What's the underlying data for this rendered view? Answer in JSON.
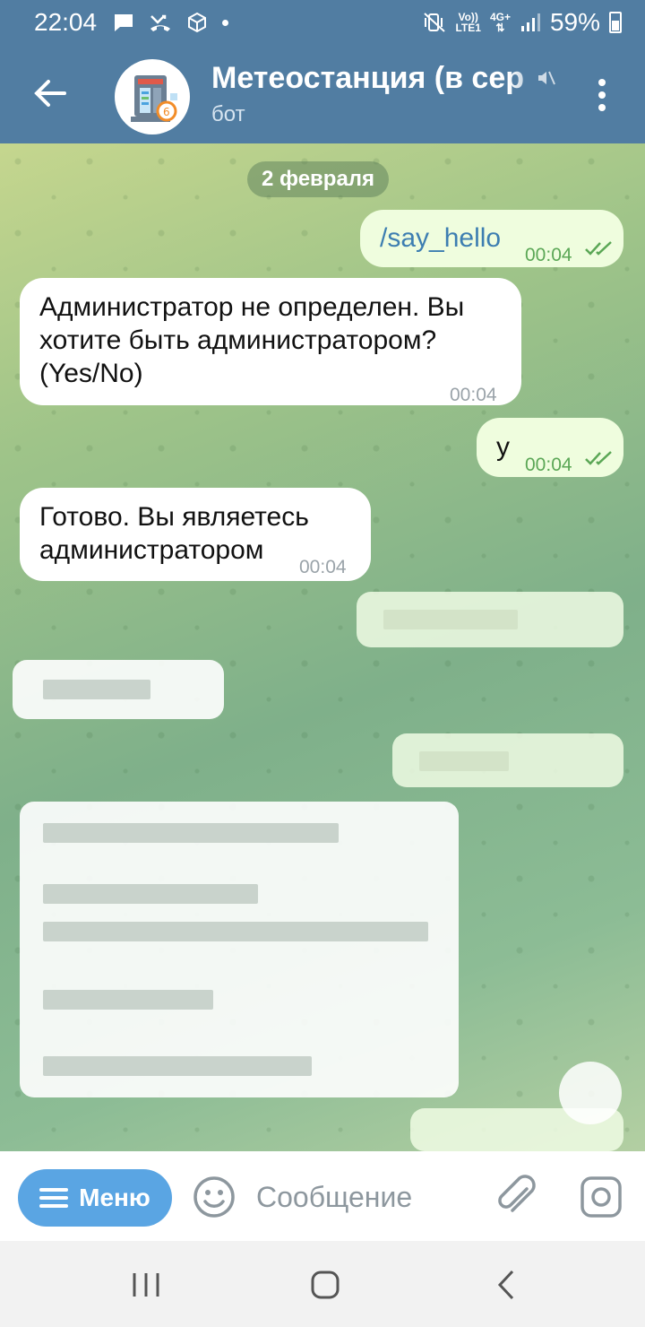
{
  "status_bar": {
    "time": "22:04",
    "network_top": "Vo))",
    "network_bottom": "LTE1",
    "network_type": "4G+",
    "battery": "59%"
  },
  "header": {
    "back_icon": "arrow-left-icon",
    "title": "Метеостанция (в сер",
    "subtitle": "бот",
    "muted_icon": "mute-icon",
    "menu_icon": "more-vert-icon"
  },
  "chat": {
    "date": "2 февраля",
    "messages": [
      {
        "direction": "out",
        "text": "/say_hello",
        "time": "00:04",
        "read": true
      },
      {
        "direction": "in",
        "text": "Администратор не определен. Вы хотите быть администратором? (Yes/No)",
        "time": "00:04"
      },
      {
        "direction": "out",
        "text": "y",
        "time": "00:04",
        "read": true
      },
      {
        "direction": "in",
        "text": "Готово. Вы являетесь администратором",
        "time": "00:04"
      }
    ]
  },
  "input_bar": {
    "menu_label": "Меню",
    "placeholder": "Сообщение"
  },
  "colors": {
    "header": "#517da2",
    "outgoing_bubble": "#effdde",
    "incoming_bubble": "#ffffff",
    "link_blue": "#3d7eb1",
    "menu_button": "#5aa5e3",
    "check_green": "#5ba756"
  }
}
